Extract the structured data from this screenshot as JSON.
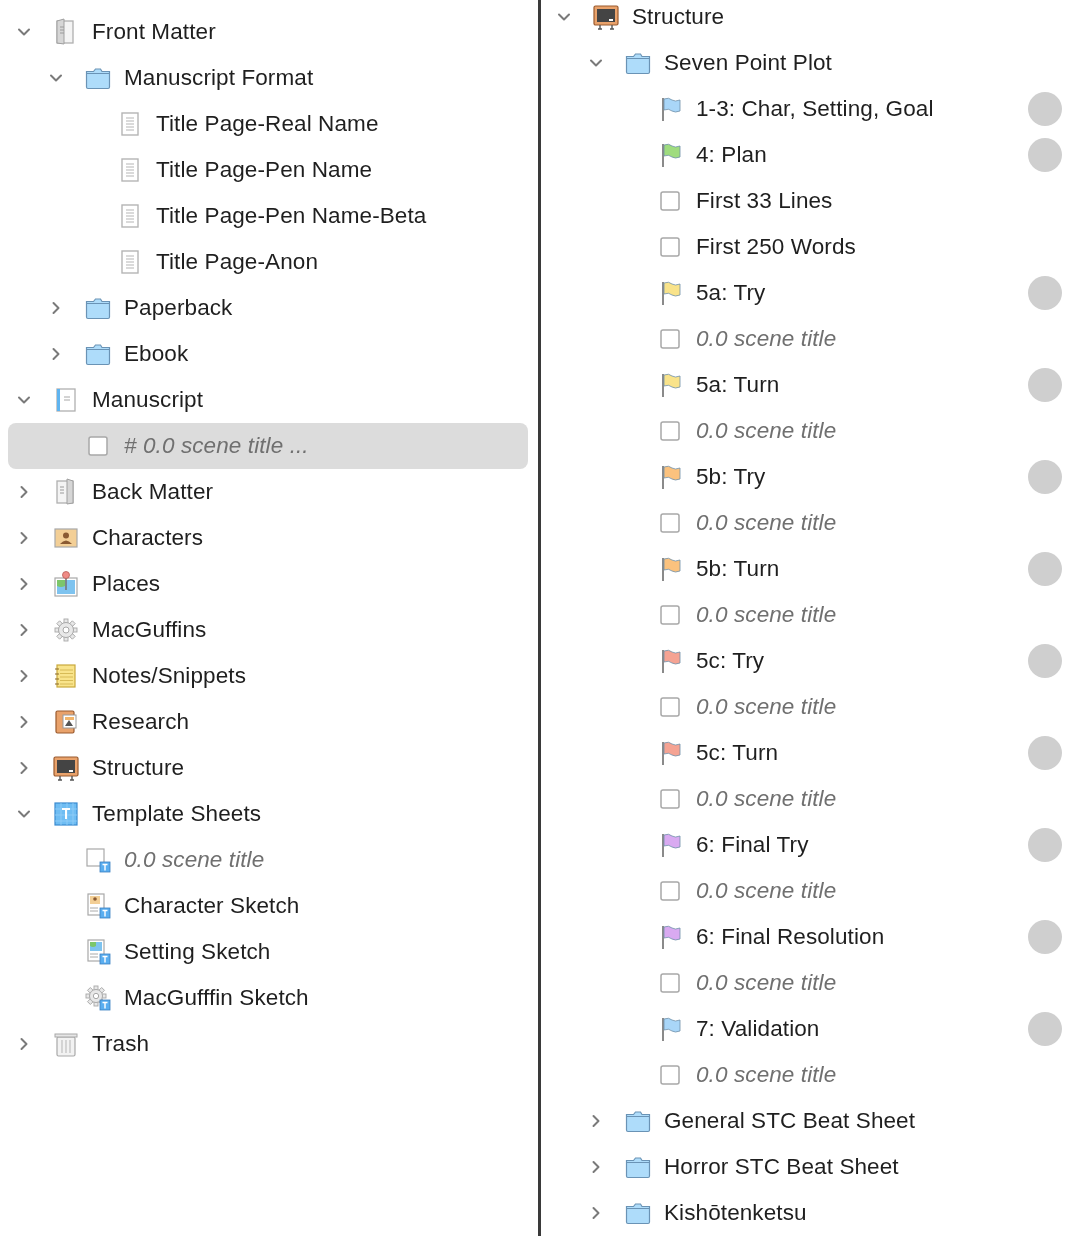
{
  "left_tree": [
    {
      "label": "Front Matter",
      "kind": "front-matter",
      "expanded": true,
      "selected": false,
      "untitled": false,
      "children": [
        {
          "label": "Manuscript Format",
          "kind": "folder",
          "expanded": true,
          "selected": false,
          "untitled": false,
          "children": [
            {
              "label": "Title Page-Real Name",
              "kind": "document",
              "selected": false,
              "untitled": false
            },
            {
              "label": "Title Page-Pen Name",
              "kind": "document",
              "selected": false,
              "untitled": false
            },
            {
              "label": "Title Page-Pen Name-Beta",
              "kind": "document",
              "selected": false,
              "untitled": false
            },
            {
              "label": "Title Page-Anon",
              "kind": "document",
              "selected": false,
              "untitled": false
            }
          ]
        },
        {
          "label": "Paperback",
          "kind": "folder",
          "expanded": false,
          "selected": false,
          "untitled": false
        },
        {
          "label": "Ebook",
          "kind": "folder",
          "expanded": false,
          "selected": false,
          "untitled": false
        }
      ]
    },
    {
      "label": "Manuscript",
      "kind": "manuscript",
      "expanded": true,
      "selected": false,
      "untitled": false,
      "children": [
        {
          "label": "# 0.0 scene title ...",
          "kind": "scene",
          "selected": true,
          "untitled": true
        }
      ]
    },
    {
      "label": "Back Matter",
      "kind": "back-matter",
      "expanded": false,
      "selected": false,
      "untitled": false
    },
    {
      "label": "Characters",
      "kind": "characters",
      "expanded": false,
      "selected": false,
      "untitled": false
    },
    {
      "label": "Places",
      "kind": "places",
      "expanded": false,
      "selected": false,
      "untitled": false
    },
    {
      "label": "MacGuffins",
      "kind": "gear",
      "expanded": false,
      "selected": false,
      "untitled": false
    },
    {
      "label": "Notes/Snippets",
      "kind": "notes",
      "expanded": false,
      "selected": false,
      "untitled": false
    },
    {
      "label": "Research",
      "kind": "research",
      "expanded": false,
      "selected": false,
      "untitled": false
    },
    {
      "label": "Structure",
      "kind": "structure",
      "expanded": false,
      "selected": false,
      "untitled": false
    },
    {
      "label": "Template Sheets",
      "kind": "template",
      "expanded": true,
      "selected": false,
      "untitled": false,
      "children": [
        {
          "label": "0.0 scene title",
          "kind": "template-scene",
          "selected": false,
          "untitled": true
        },
        {
          "label": "Character Sketch",
          "kind": "template-character",
          "selected": false,
          "untitled": false
        },
        {
          "label": "Setting Sketch",
          "kind": "template-setting",
          "selected": false,
          "untitled": false
        },
        {
          "label": "MacGufffin Sketch",
          "kind": "template-gear",
          "selected": false,
          "untitled": false
        }
      ]
    },
    {
      "label": "Trash",
      "kind": "trash",
      "expanded": false,
      "selected": false,
      "untitled": false
    }
  ],
  "right_tree": [
    {
      "label": "Structure",
      "kind": "structure",
      "expanded": true,
      "selected": false,
      "untitled": false,
      "children": [
        {
          "label": "Seven Point Plot",
          "kind": "folder",
          "expanded": true,
          "selected": false,
          "untitled": false,
          "children": [
            {
              "label": "1-3: Char, Setting, Goal",
              "kind": "flag",
              "color": "#a9d6f8",
              "label_dot": true,
              "selected": false,
              "untitled": false
            },
            {
              "label": "4: Plan",
              "kind": "flag",
              "color": "#9fdc7e",
              "label_dot": true,
              "selected": false,
              "untitled": false
            },
            {
              "label": "First 33 Lines",
              "kind": "scene",
              "label_dot": false,
              "selected": false,
              "untitled": false
            },
            {
              "label": "First 250 Words",
              "kind": "scene",
              "label_dot": false,
              "selected": false,
              "untitled": false
            },
            {
              "label": "5a: Try",
              "kind": "flag",
              "color": "#f9e38a",
              "label_dot": true,
              "selected": false,
              "untitled": false
            },
            {
              "label": "0.0 scene title",
              "kind": "scene",
              "label_dot": false,
              "selected": false,
              "untitled": true
            },
            {
              "label": "5a: Turn",
              "kind": "flag",
              "color": "#f9e38a",
              "label_dot": true,
              "selected": false,
              "untitled": false
            },
            {
              "label": "0.0 scene title",
              "kind": "scene",
              "label_dot": false,
              "selected": false,
              "untitled": true
            },
            {
              "label": "5b: Try",
              "kind": "flag",
              "color": "#fbc27e",
              "label_dot": true,
              "selected": false,
              "untitled": false
            },
            {
              "label": "0.0 scene title",
              "kind": "scene",
              "label_dot": false,
              "selected": false,
              "untitled": true
            },
            {
              "label": "5b: Turn",
              "kind": "flag",
              "color": "#fbc27e",
              "label_dot": true,
              "selected": false,
              "untitled": false
            },
            {
              "label": "0.0 scene title",
              "kind": "scene",
              "label_dot": false,
              "selected": false,
              "untitled": true
            },
            {
              "label": "5c: Try",
              "kind": "flag",
              "color": "#f5a393",
              "label_dot": true,
              "selected": false,
              "untitled": false
            },
            {
              "label": "0.0 scene title",
              "kind": "scene",
              "label_dot": false,
              "selected": false,
              "untitled": true
            },
            {
              "label": "5c: Turn",
              "kind": "flag",
              "color": "#f5a393",
              "label_dot": true,
              "selected": false,
              "untitled": false
            },
            {
              "label": "0.0 scene title",
              "kind": "scene",
              "label_dot": false,
              "selected": false,
              "untitled": true
            },
            {
              "label": "6: Final Try",
              "kind": "flag",
              "color": "#d9aaf1",
              "label_dot": true,
              "selected": false,
              "untitled": false
            },
            {
              "label": "0.0 scene title",
              "kind": "scene",
              "label_dot": false,
              "selected": false,
              "untitled": true
            },
            {
              "label": "6: Final Resolution",
              "kind": "flag",
              "color": "#d9aaf1",
              "label_dot": true,
              "selected": false,
              "untitled": false
            },
            {
              "label": "0.0 scene title",
              "kind": "scene",
              "label_dot": false,
              "selected": false,
              "untitled": true
            },
            {
              "label": "7: Validation",
              "kind": "flag",
              "color": "#a9d6f8",
              "label_dot": true,
              "selected": false,
              "untitled": false
            },
            {
              "label": "0.0 scene title",
              "kind": "scene",
              "label_dot": false,
              "selected": false,
              "untitled": true
            }
          ]
        },
        {
          "label": "General STC Beat Sheet",
          "kind": "folder",
          "expanded": false,
          "selected": false,
          "untitled": false
        },
        {
          "label": "Horror STC Beat Sheet",
          "kind": "folder",
          "expanded": false,
          "selected": false,
          "untitled": false
        },
        {
          "label": "Kishōtenketsu",
          "kind": "folder",
          "expanded": false,
          "selected": false,
          "untitled": false
        }
      ]
    }
  ]
}
